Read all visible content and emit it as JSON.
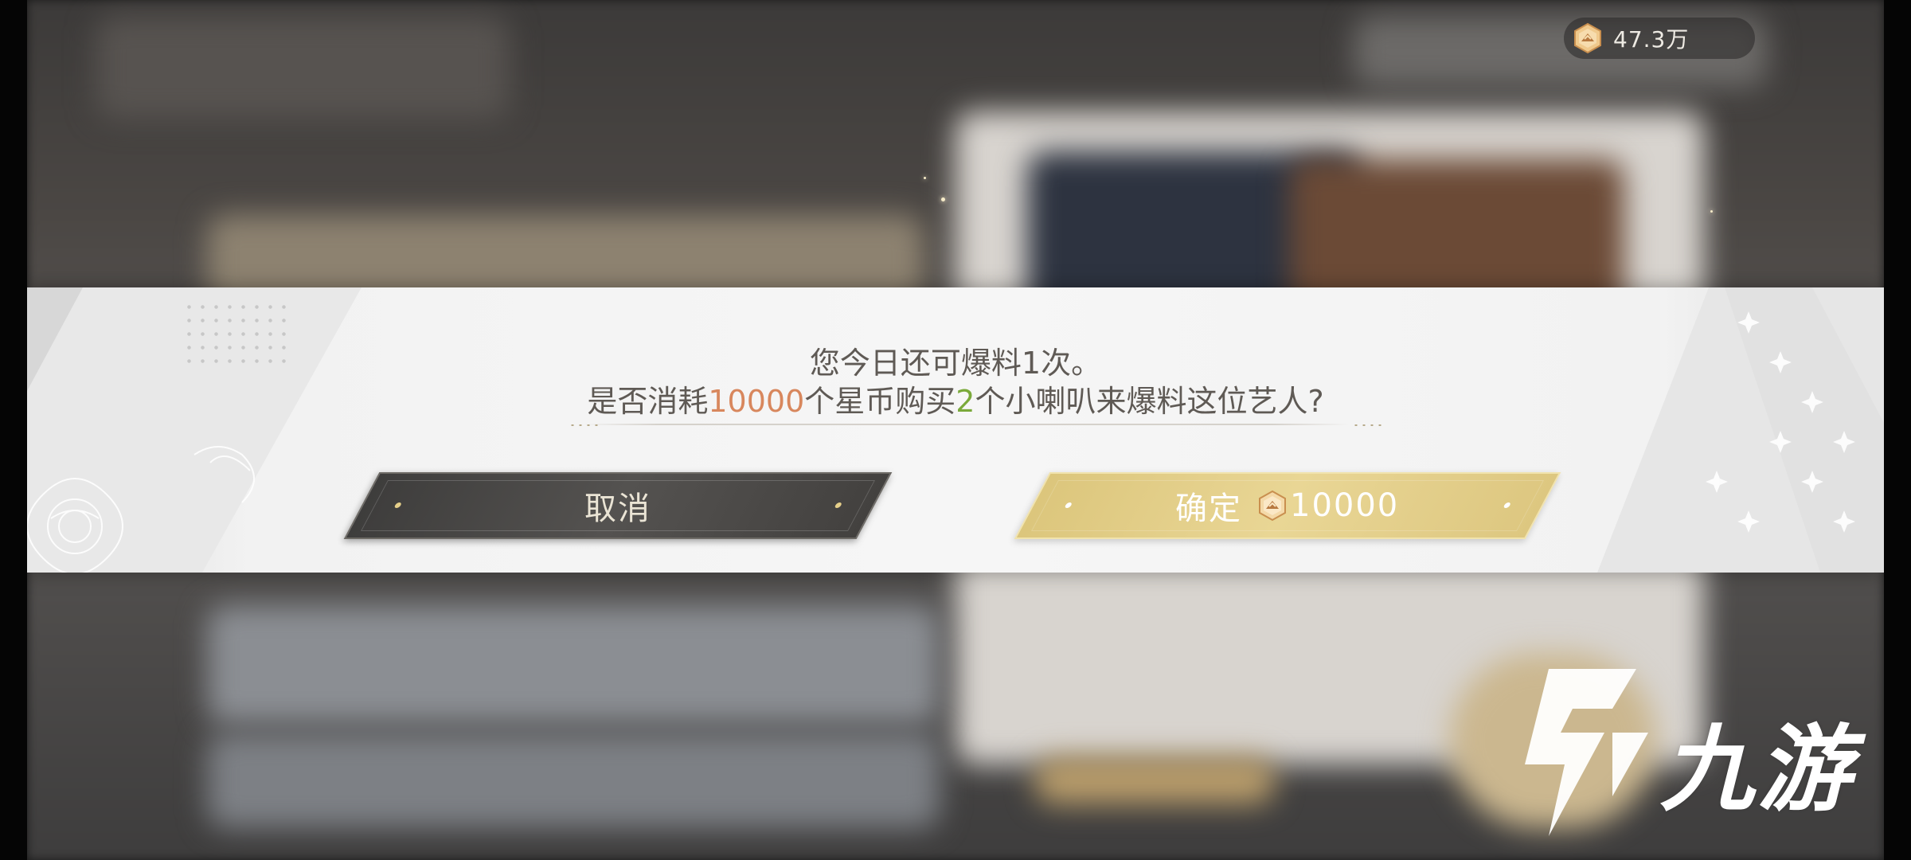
{
  "currency": {
    "icon": "star-coin-icon",
    "value": "47.3万"
  },
  "dialog": {
    "line1": "您今日还可爆料1次。",
    "line2": {
      "part1": "是否消耗",
      "cost": "10000",
      "part2": "个星币购买",
      "count": "2",
      "part3": "个小喇叭来爆料这位艺人?"
    }
  },
  "buttons": {
    "cancel_label": "取消",
    "confirm_label": "确定",
    "confirm_cost": "10000"
  },
  "watermark": {
    "text": "九游"
  },
  "colors": {
    "cost_highlight": "#d8875d",
    "count_highlight": "#7aa93a",
    "confirm_gold": "#e2cf8a",
    "cancel_dark": "#4a4846"
  }
}
